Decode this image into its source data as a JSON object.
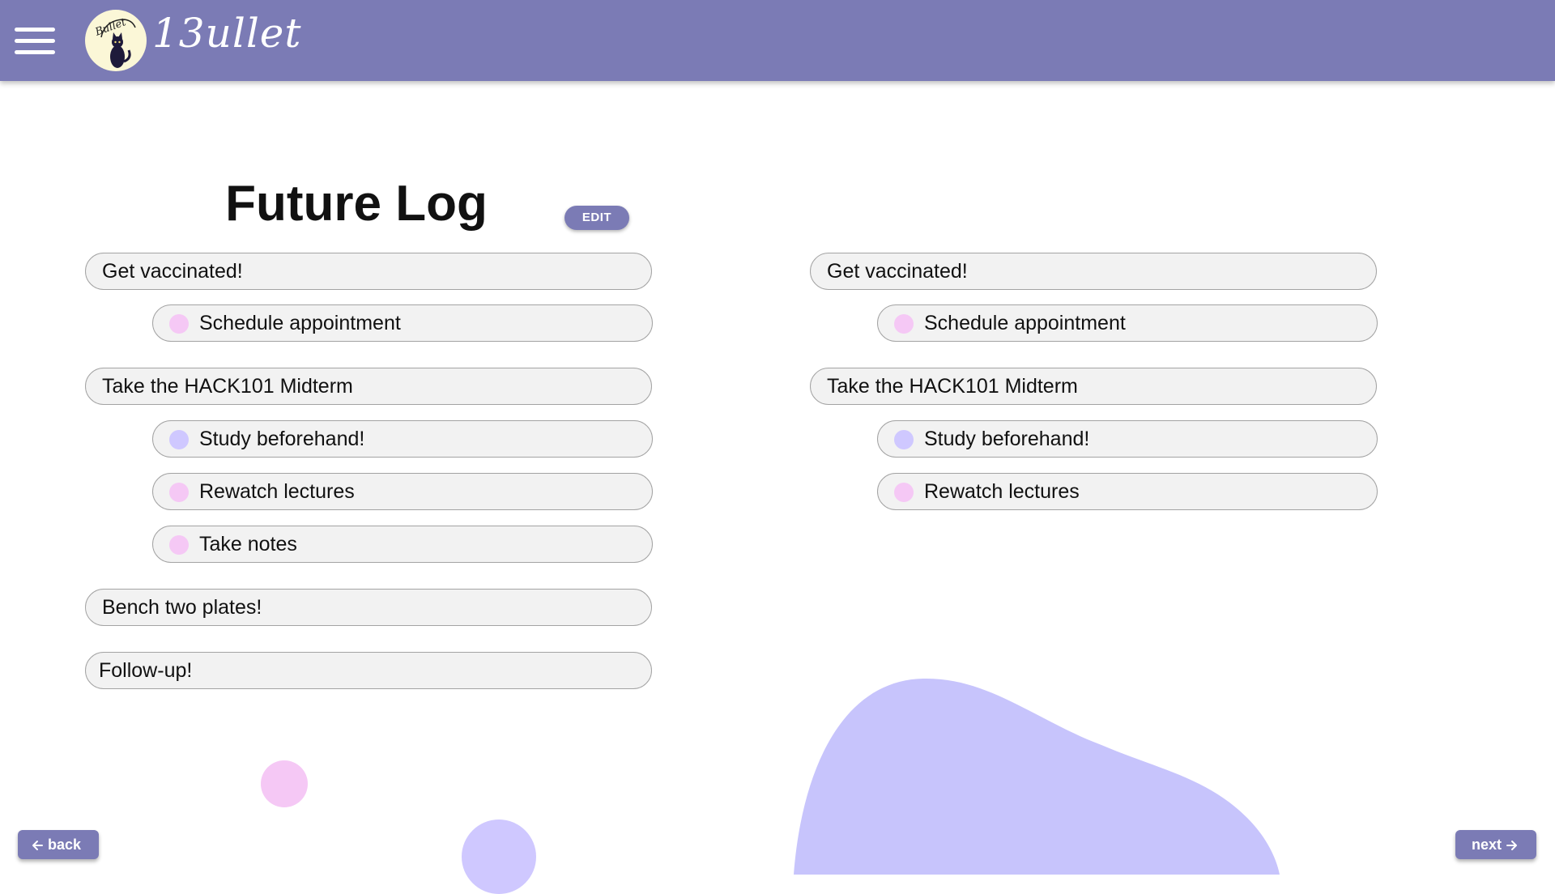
{
  "header": {
    "brand": "Bullet",
    "brand_display": "13ullet",
    "logo_label": "Bullet",
    "bg_color": "#7b7bb5"
  },
  "page": {
    "title": "Future Log",
    "edit_label": "EDIT"
  },
  "left_column": {
    "items": [
      {
        "type": "task",
        "label": "Get vaccinated!"
      },
      {
        "type": "sub",
        "label": "Schedule appointment",
        "dot_color": "#f5c8f5"
      },
      {
        "type": "task",
        "label": "Take the HACK101 Midterm"
      },
      {
        "type": "sub",
        "label": "Study beforehand!",
        "dot_color": "#cfc8ff"
      },
      {
        "type": "sub",
        "label": "Rewatch lectures",
        "dot_color": "#f5c8f5"
      },
      {
        "type": "sub",
        "label": "Take notes",
        "dot_color": "#f5c8f5"
      },
      {
        "type": "task",
        "label": "Bench two plates!"
      },
      {
        "type": "task",
        "label": "Follow-up!"
      }
    ]
  },
  "right_column": {
    "items": [
      {
        "type": "task",
        "label": "Get vaccinated!"
      },
      {
        "type": "sub",
        "label": "Schedule appointment",
        "dot_color": "#f5c8f5"
      },
      {
        "type": "task",
        "label": "Take the HACK101 Midterm"
      },
      {
        "type": "sub",
        "label": "Study beforehand!",
        "dot_color": "#cfc8ff"
      },
      {
        "type": "sub",
        "label": "Rewatch lectures",
        "dot_color": "#f5c8f5"
      }
    ]
  },
  "nav": {
    "back_label": "back",
    "next_label": "next",
    "back_icon": "arrow-left-icon",
    "next_icon": "arrow-right-icon"
  },
  "colors": {
    "accent": "#7b7bb5",
    "pill_bg": "#f2f2f2",
    "pill_border": "#a3a3a3",
    "pink": "#f5c8f5",
    "lavender": "#cfc8ff",
    "blob": "#c7c4fc"
  }
}
